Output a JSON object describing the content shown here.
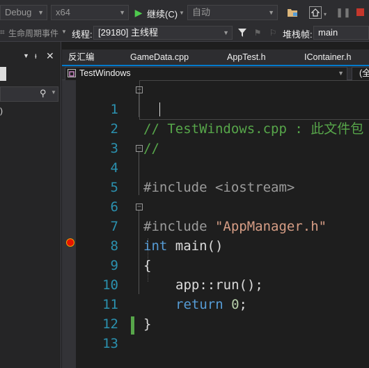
{
  "toolbar": {
    "config_combo": "Debug",
    "platform_combo": "x64",
    "continue_label": "继续(C)",
    "auto_combo": "自动"
  },
  "debug_bar": {
    "lifecycle_label": "生命周期事件",
    "thread_label": "线程:",
    "thread_value": "[29180] 主线程",
    "stackframe_label": "堆栈帧:",
    "stackframe_value": "main"
  },
  "left_panel": {
    "pin_glyph": "ᵖ",
    "close_glyph": "✕"
  },
  "tabs": [
    {
      "label": "反汇编"
    },
    {
      "label": "GameData.cpp"
    },
    {
      "label": "AppTest.h"
    },
    {
      "label": "IContainer.h"
    }
  ],
  "nav": {
    "scope": "TestWindows",
    "scope_right": "(全"
  },
  "editor": {
    "lines": [
      {
        "n": "1",
        "text": "// TestWindows.cpp : 此文件包"
      },
      {
        "n": "2",
        "text": "//"
      },
      {
        "n": "3",
        "text": ""
      },
      {
        "n": "4",
        "text": "#include <iostream>"
      },
      {
        "n": "5",
        "text": ""
      },
      {
        "n": "6",
        "pp": "#include ",
        "str": "\"AppManager.h\""
      },
      {
        "n": "7",
        "kw": "int",
        "rest": " main()"
      },
      {
        "n": "8",
        "text": "{"
      },
      {
        "n": "9",
        "text": "app::run();"
      },
      {
        "n": "10",
        "kw": "return",
        "num": " 0",
        "rest": ";"
      },
      {
        "n": "11",
        "text": "}"
      },
      {
        "n": "12",
        "text": ""
      },
      {
        "n": "13",
        "text": ""
      }
    ]
  },
  "colors": {
    "accent": "#007acc",
    "comment": "#57a64a",
    "keyword": "#569cd6",
    "string": "#d69d85",
    "line_number": "#2b91af"
  }
}
